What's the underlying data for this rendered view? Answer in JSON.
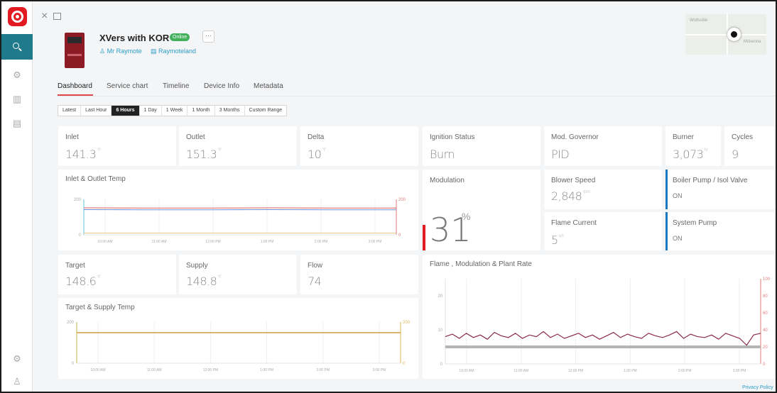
{
  "header": {
    "device_title": "XVers with KOR",
    "status_badge": "Online",
    "more_label": "···",
    "user_link": "Mr Raymote",
    "location_link": "Raymoteland"
  },
  "map": {
    "town_north": "Wolfsville",
    "town_east": "Mckenna"
  },
  "tabs": [
    {
      "label": "Dashboard",
      "active": true
    },
    {
      "label": "Service chart",
      "active": false
    },
    {
      "label": "Timeline",
      "active": false
    },
    {
      "label": "Device Info",
      "active": false
    },
    {
      "label": "Metadata",
      "active": false
    }
  ],
  "ranges": [
    {
      "label": "Latest",
      "active": false
    },
    {
      "label": "Last Hour",
      "active": false
    },
    {
      "label": "6 Hours",
      "active": true
    },
    {
      "label": "1 Day",
      "active": false
    },
    {
      "label": "1 Week",
      "active": false
    },
    {
      "label": "1 Month",
      "active": false
    },
    {
      "label": "3 Months",
      "active": false
    },
    {
      "label": "Custom Range",
      "active": false
    }
  ],
  "metrics": {
    "inlet": {
      "label": "Inlet",
      "value": "141.3",
      "unit": "°F"
    },
    "outlet": {
      "label": "Outlet",
      "value": "151.3",
      "unit": "°F"
    },
    "delta": {
      "label": "Delta",
      "value": "10",
      "unit": "°F"
    },
    "ignition": {
      "label": "Ignition Status",
      "value": "Burn"
    },
    "mod_governor": {
      "label": "Mod. Governor",
      "value": "PID"
    },
    "burner": {
      "label": "Burner",
      "value": "3,073",
      "unit": "hr"
    },
    "cycles": {
      "label": "Cycles",
      "value": "9"
    },
    "modulation": {
      "label": "Modulation",
      "value": "31",
      "unit": "%"
    },
    "blower": {
      "label": "Blower Speed",
      "value": "2,848",
      "unit": "rpm"
    },
    "flame_current": {
      "label": "Flame Current",
      "value": "5",
      "unit": "uA"
    },
    "boiler_pump": {
      "label": "Boiler Pump / Isol Valve",
      "value": "ON"
    },
    "system_pump": {
      "label": "System Pump",
      "value": "ON"
    },
    "target": {
      "label": "Target",
      "value": "148.6",
      "unit": "°F"
    },
    "supply": {
      "label": "Supply",
      "value": "148.8",
      "unit": "°F"
    },
    "flow": {
      "label": "Flow",
      "value": "74"
    }
  },
  "footer": {
    "privacy": "Privacy Policy"
  },
  "colors": {
    "accent_red": "#e21b23",
    "nav_teal": "#1f7a8c",
    "link_blue": "#2d9cc7",
    "pump_blue": "#1878c2"
  },
  "chart_data": [
    {
      "type": "line",
      "title": "Inlet & Outlet Temp",
      "x": [
        "10:00 AM",
        "11:00 AM",
        "12:00 PM",
        "1:00 PM",
        "2:00 PM",
        "3:00 PM"
      ],
      "ylim": [
        0,
        200
      ],
      "y2lim": [
        0,
        200
      ],
      "y_ticks": [
        "200",
        "0"
      ],
      "y2_ticks": [
        "200",
        "0"
      ],
      "series": [
        {
          "name": "",
          "color": "#e05b5b",
          "values": [
            152,
            151,
            151,
            152,
            151,
            151
          ]
        },
        {
          "name": "",
          "color": "#6a8fd8",
          "values": [
            142,
            141,
            141,
            142,
            141,
            141
          ]
        },
        {
          "name": "",
          "color": "#e8c98a",
          "values": [
            10,
            10,
            10,
            10,
            10,
            10
          ]
        }
      ]
    },
    {
      "type": "line",
      "title": "Target & Supply Temp",
      "x": [
        "10:00 AM",
        "11:00 AM",
        "12:00 PM",
        "1:00 PM",
        "2:00 PM",
        "3:00 PM"
      ],
      "ylim": [
        0,
        200
      ],
      "y2lim": [
        0,
        200
      ],
      "y_ticks": [
        "200",
        "0"
      ],
      "y2_ticks": [
        "200",
        "0"
      ],
      "series": [
        {
          "name": "",
          "color": "#8a6a2a",
          "values": [
            149,
            149,
            149,
            149,
            149,
            149
          ]
        },
        {
          "name": "",
          "color": "#e0a84a",
          "values": [
            148,
            148,
            148,
            148,
            148,
            148
          ]
        }
      ]
    },
    {
      "type": "line",
      "title": "Flame , Modulation & Plant Rate",
      "x": [
        "10:00 AM",
        "11:00 AM",
        "12:00 PM",
        "1:00 PM",
        "2:00 PM",
        "3:00 PM"
      ],
      "ylim": [
        0,
        25
      ],
      "y2lim": [
        0,
        100
      ],
      "y_ticks": [
        "20",
        "10",
        "0"
      ],
      "y2_ticks": [
        "100",
        "80",
        "60",
        "40",
        "20",
        "0"
      ],
      "series": [
        {
          "name": "",
          "color": "#8b2b4b",
          "values": [
            32,
            35,
            30,
            36,
            31,
            34,
            29,
            37,
            33,
            31,
            36,
            30,
            34,
            32,
            38,
            31,
            35,
            30,
            33,
            36,
            31,
            34,
            29,
            33,
            37,
            31,
            35,
            32,
            30,
            36,
            33,
            31,
            34,
            38,
            30,
            35,
            32,
            31,
            34,
            29,
            36,
            33,
            30,
            22,
            34,
            36
          ]
        },
        {
          "name": "",
          "color": "#b5b5b5",
          "values": [
            5,
            5,
            5,
            5,
            5,
            5,
            5,
            5,
            5,
            5,
            5,
            5,
            5,
            5,
            5,
            5,
            5,
            5,
            5,
            5,
            5,
            5,
            5,
            5,
            5,
            5,
            5,
            5,
            5,
            5,
            5,
            5,
            5,
            5,
            5,
            5,
            5,
            5,
            5,
            5,
            5,
            5,
            5,
            5,
            5,
            5
          ]
        }
      ]
    }
  ]
}
